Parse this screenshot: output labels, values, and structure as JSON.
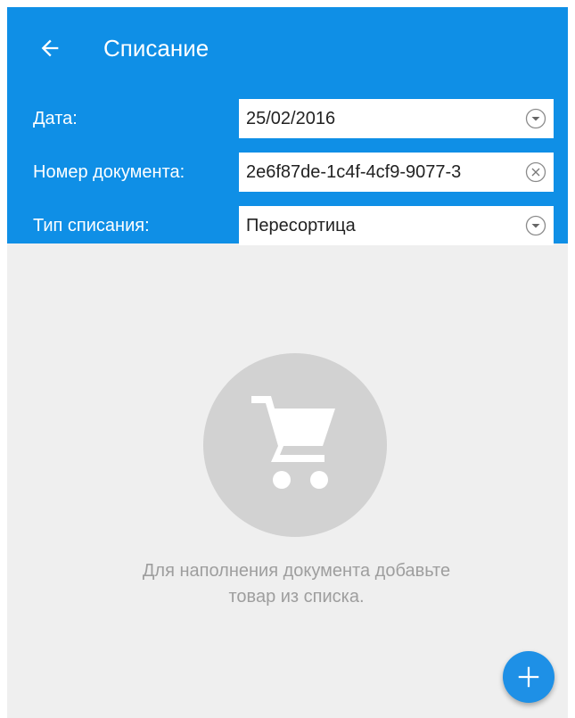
{
  "header": {
    "title": "Списание",
    "back_icon": "arrow-left-icon",
    "background_color": "#0f8fe6"
  },
  "form": {
    "date": {
      "label": "Дата:",
      "value": "25/02/2016",
      "icon": "chevron-down-circle-icon"
    },
    "document_number": {
      "label": "Номер документа:",
      "value": "2e6f87de-1c4f-4cf9-9077-3",
      "icon": "clear-circle-icon"
    },
    "writeoff_type": {
      "label": "Тип списания:",
      "value": "Пересортица",
      "icon": "chevron-down-circle-icon"
    }
  },
  "empty_state": {
    "icon": "shopping-cart-icon",
    "message_line1": "Для наполнения документа добавьте",
    "message_line2": "товар из списка."
  },
  "fab": {
    "icon": "plus-icon",
    "color": "#1e90e6"
  }
}
